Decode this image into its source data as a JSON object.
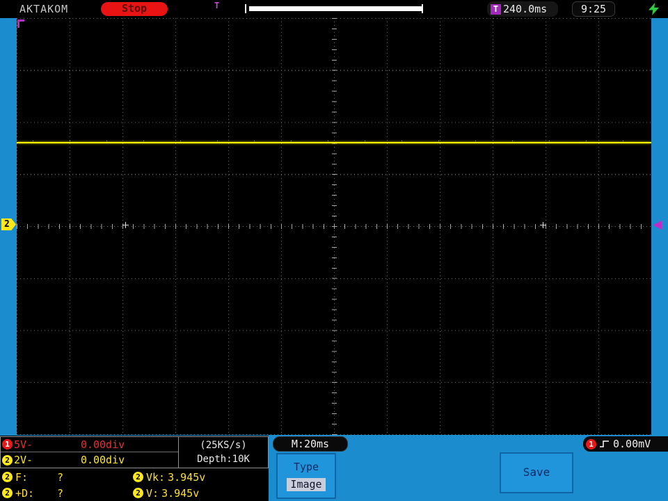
{
  "colors": {
    "bg_blue": "#1B8CCE",
    "trace_yellow": "#FFFF00",
    "ch1_red": "#E81818",
    "ch2_yellow": "#FFE81A",
    "trigger_purple": "#B32CC4",
    "button_blue": "#2095DB"
  },
  "top_bar": {
    "brand": "AKTAKOM",
    "run_state": "Stop",
    "trigger_pos_marker": "T",
    "trigger_time_icon": "T",
    "trigger_time": "240.0ms",
    "clock": "9:25"
  },
  "scope": {
    "ch2_ground_marker": "2"
  },
  "bottom": {
    "ch1": {
      "num": "1",
      "scale": "5V-",
      "offset": "0.00div"
    },
    "ch2": {
      "num": "2",
      "scale": "2V-",
      "offset": "0.00div"
    },
    "sample_rate": "(25KS/s)",
    "depth": "Depth:10K",
    "timebase": "M:20ms",
    "meas": {
      "f": {
        "ch": "2",
        "label": "F:",
        "value": "?"
      },
      "vk": {
        "ch": "2",
        "label": "Vk:",
        "value": "3.945v"
      },
      "d": {
        "ch": "2",
        "label": "+D:",
        "value": "?"
      },
      "v": {
        "ch": "2",
        "label": "V:",
        "value": "3.945v"
      }
    },
    "type_button": {
      "title": "Type",
      "value": "Image"
    },
    "save_label": "Save",
    "trigger": {
      "ch": "1",
      "level": "0.00mV"
    }
  }
}
